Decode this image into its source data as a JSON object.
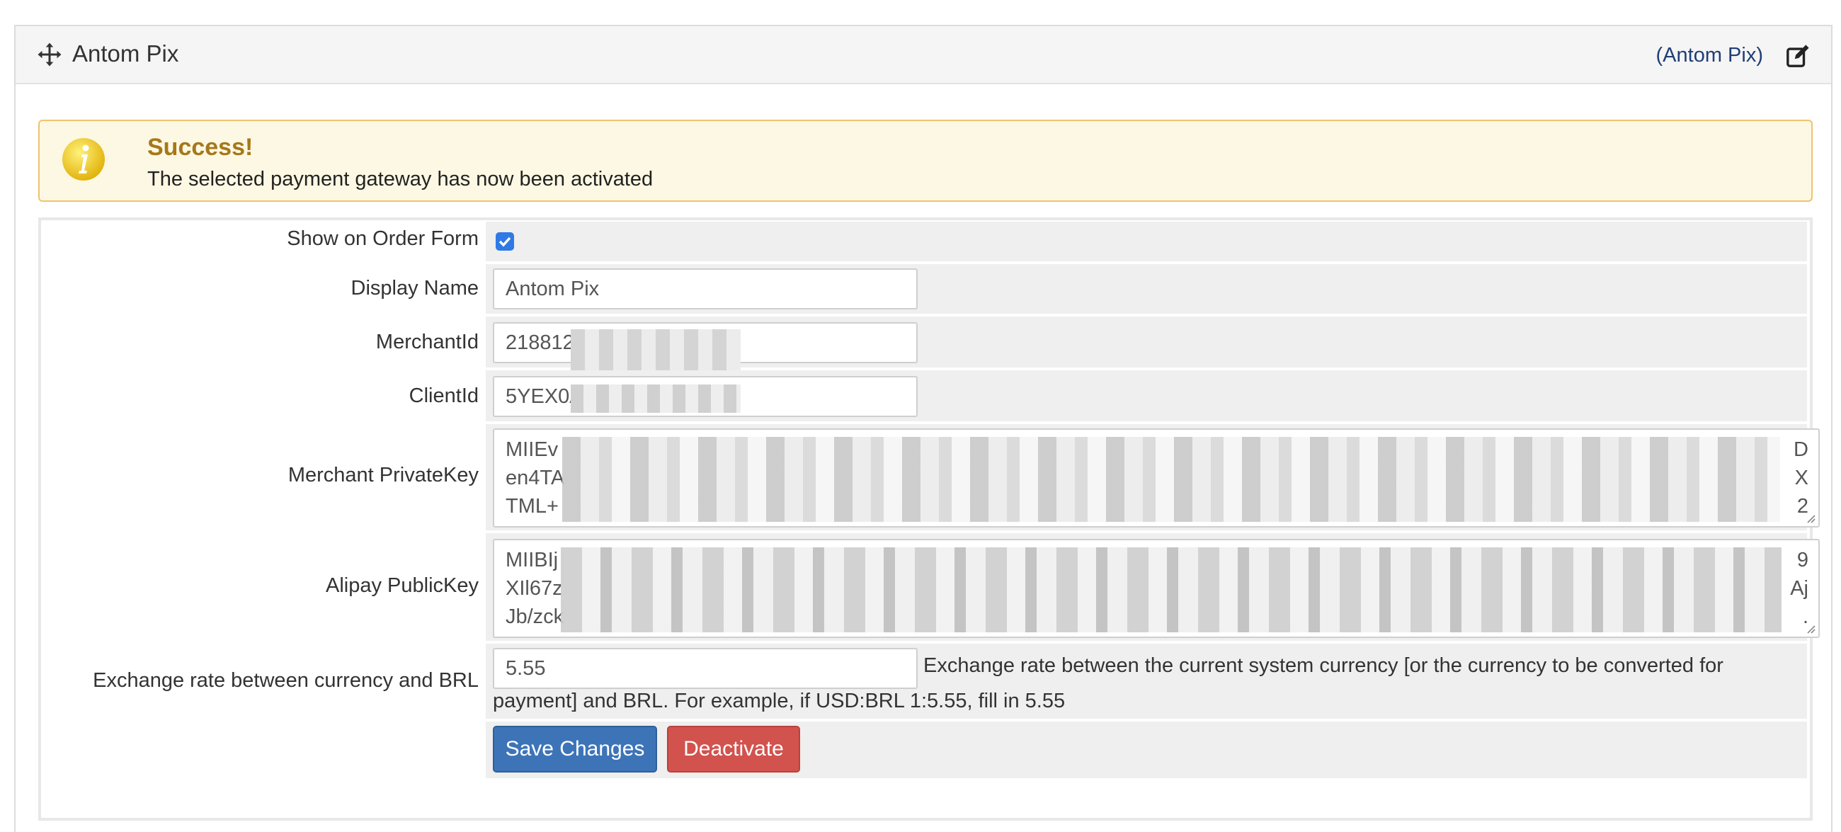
{
  "panel": {
    "title": "Antom Pix",
    "header_link": "(Antom Pix)"
  },
  "alert": {
    "title": "Success!",
    "message": "The selected payment gateway has now been activated"
  },
  "form": {
    "show_on_order_form": {
      "label": "Show on Order Form",
      "checked": true
    },
    "display_name": {
      "label": "Display Name",
      "value": "Antom Pix"
    },
    "merchant_id": {
      "label": "MerchantId",
      "value": "2188120"
    },
    "client_id": {
      "label": "ClientId",
      "value": "5YEX0A3"
    },
    "merchant_private_key": {
      "label": "Merchant PrivateKey",
      "lines": [
        "MIIEv",
        "en4TA",
        "TML+"
      ],
      "line_ends": [
        "D",
        "X",
        "2"
      ]
    },
    "alipay_public_key": {
      "label": "Alipay PublicKey",
      "lines": [
        "MIIBIj",
        "XIl67z",
        "Jb/zck"
      ],
      "line_ends": [
        "9",
        "Aj",
        "."
      ]
    },
    "exchange_rate": {
      "label": "Exchange rate between currency and BRL",
      "value": "5.55",
      "help_line1": "Exchange rate between the current system currency [or the currency to be converted for",
      "help_line2": "payment] and BRL. For example, if USD:BRL 1:5.55, fill in 5.55"
    },
    "buttons": {
      "save": "Save Changes",
      "deactivate": "Deactivate"
    }
  },
  "colors": {
    "primary": "#3d74b8",
    "danger": "#d2524d",
    "alert_bg": "#fcf8e3",
    "alert_title": "#a6781a",
    "link": "#1f3f75"
  }
}
